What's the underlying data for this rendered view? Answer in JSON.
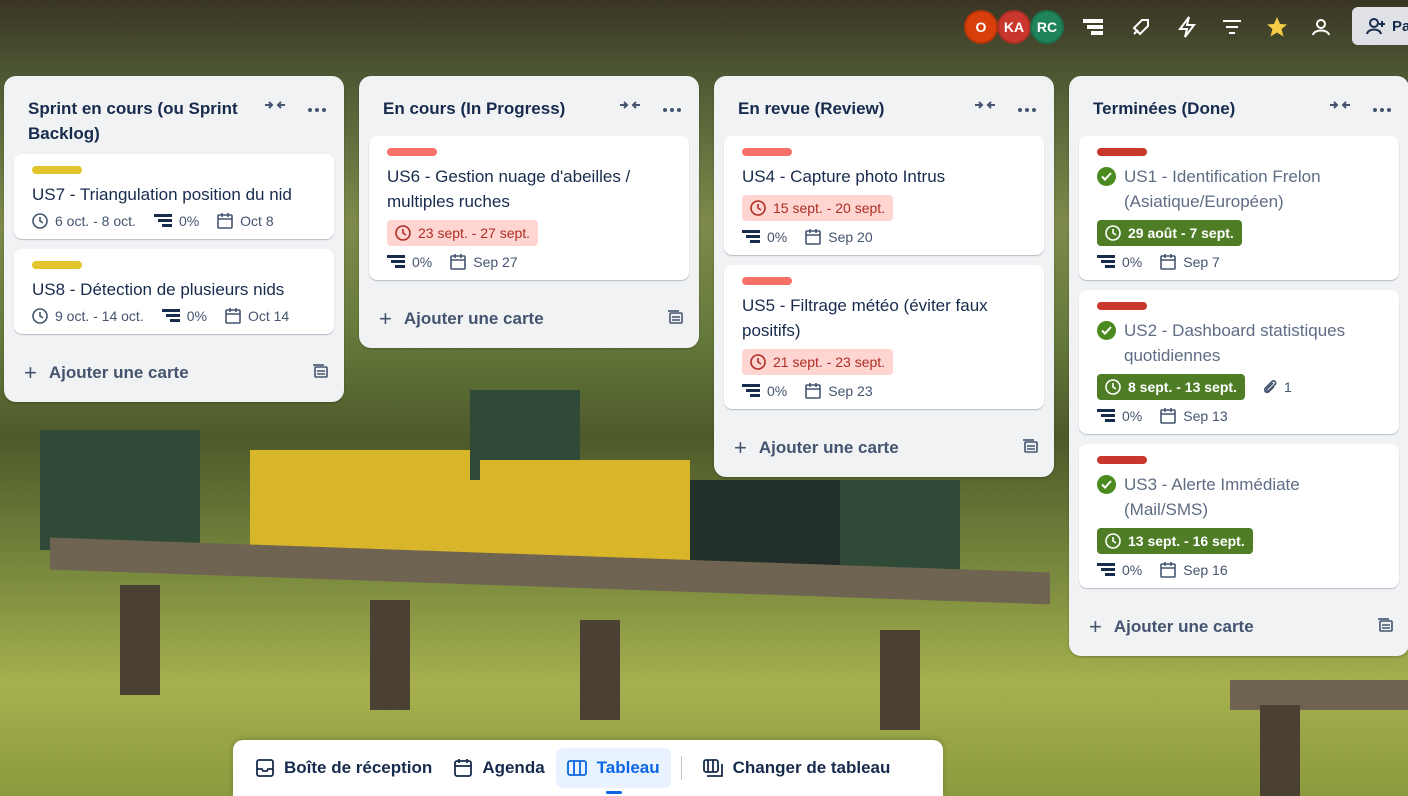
{
  "topbar": {
    "avatars": [
      {
        "initials": "O",
        "color": "#d93f0b"
      },
      {
        "initials": "KA",
        "color": "#c9372c"
      },
      {
        "initials": "RC",
        "color": "#1f845a"
      }
    ],
    "icons": [
      "board-filter-icon",
      "power-ups-icon",
      "automation-icon",
      "filter-icon",
      "star-icon",
      "visibility-icon"
    ],
    "share_label": "Pa"
  },
  "lists": [
    {
      "title": "Sprint en cours (ou Sprint Backlog)",
      "add_label": "Ajouter une carte",
      "cards": [
        {
          "label_color": "#e2c52a",
          "title": "US7 - Triangulation position du nid",
          "date_range": "6 oct. - 8 oct.",
          "progress": "0%",
          "due": "Oct 8"
        },
        {
          "label_color": "#e2c52a",
          "title": "US8 - Détection de plusieurs nids",
          "date_range": "9 oct. - 14 oct.",
          "progress": "0%",
          "due": "Oct 14"
        }
      ]
    },
    {
      "title": "En cours (In Progress)",
      "add_label": "Ajouter une carte",
      "cards": [
        {
          "label_color": "#f87168",
          "title": "US6 - Gestion nuage d'abeilles / multiples ruches",
          "date_range": "23 sept. - 27 sept.",
          "progress": "0%",
          "due": "Sep 27"
        }
      ]
    },
    {
      "title": "En revue (Review)",
      "add_label": "Ajouter une carte",
      "cards": [
        {
          "label_color": "#f87168",
          "title": "US4 - Capture photo Intrus",
          "date_range": "15 sept. - 20 sept.",
          "progress": "0%",
          "due": "Sep 20"
        },
        {
          "label_color": "#f87168",
          "title": "US5 - Filtrage météo (éviter faux positifs)",
          "date_range": "21 sept. - 23 sept.",
          "progress": "0%",
          "due": "Sep 23"
        }
      ]
    },
    {
      "title": "Terminées (Done)",
      "add_label": "Ajouter une carte",
      "cards": [
        {
          "label_color": "#c9372c",
          "title": "US1 - Identification Frelon (Asiatique/Européen)",
          "date_range": "29 août - 7 sept.",
          "progress": "0%",
          "due": "Sep 7"
        },
        {
          "label_color": "#c9372c",
          "title": "US2 - Dashboard statistiques quotidiennes",
          "date_range": "8 sept. - 13 sept.",
          "attachments": "1",
          "progress": "0%",
          "due": "Sep 13"
        },
        {
          "label_color": "#c9372c",
          "title": "US3 - Alerte Immédiate (Mail/SMS)",
          "date_range": "13 sept. - 16 sept.",
          "progress": "0%",
          "due": "Sep 16"
        }
      ]
    }
  ],
  "bottom_nav": {
    "inbox": "Boîte de réception",
    "planner": "Agenda",
    "board": "Tableau",
    "switch": "Changer de tableau"
  }
}
